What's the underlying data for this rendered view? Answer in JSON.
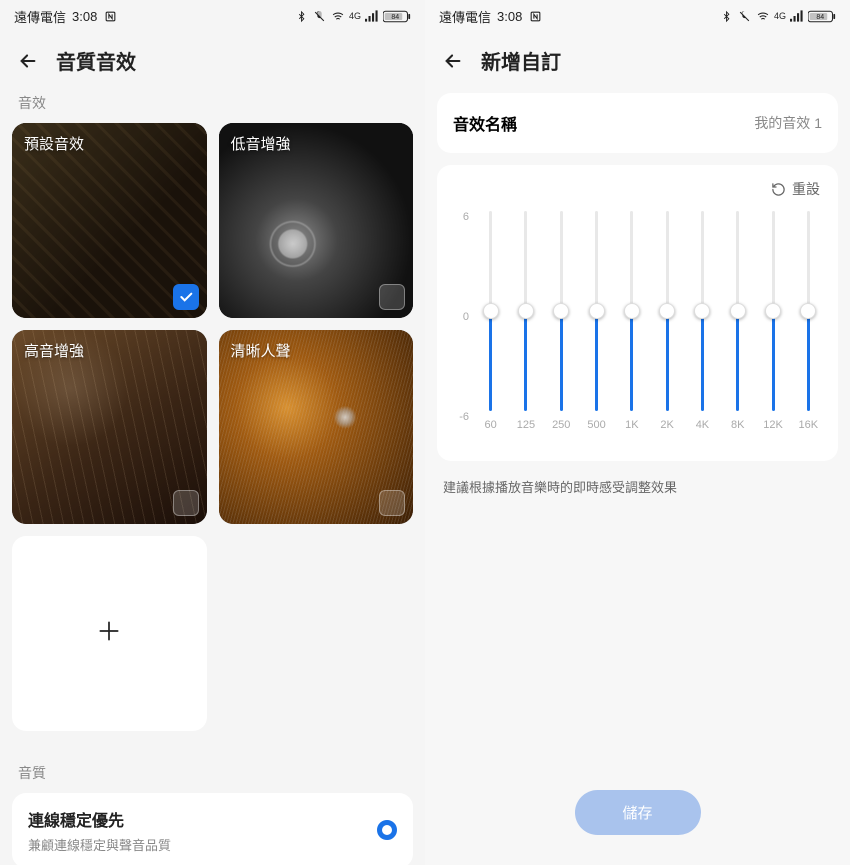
{
  "status": {
    "carrier": "遠傳電信",
    "time": "3:08",
    "nfc": "ℕ",
    "battery": "84"
  },
  "left": {
    "title": "音質音效",
    "section_effects": "音效",
    "effects": [
      {
        "label": "預設音效",
        "checked": true
      },
      {
        "label": "低音增強",
        "checked": false
      },
      {
        "label": "高音增強",
        "checked": false
      },
      {
        "label": "清晰人聲",
        "checked": false
      }
    ],
    "section_quality": "音質",
    "quality": {
      "title": "連線穩定優先",
      "sub": "兼顧連線穩定與聲音品質"
    }
  },
  "right": {
    "title": "新增自訂",
    "name_label": "音效名稱",
    "name_value": "我的音效 1",
    "reset": "重設",
    "y_max": "6",
    "y_zero": "0",
    "y_min": "-6",
    "freqs": [
      "60",
      "125",
      "250",
      "500",
      "1K",
      "2K",
      "4K",
      "8K",
      "12K",
      "16K"
    ],
    "values": [
      0,
      0,
      0,
      0,
      0,
      0,
      0,
      0,
      0,
      0
    ],
    "hint": "建議根據播放音樂時的即時感受調整效果",
    "save": "儲存"
  }
}
